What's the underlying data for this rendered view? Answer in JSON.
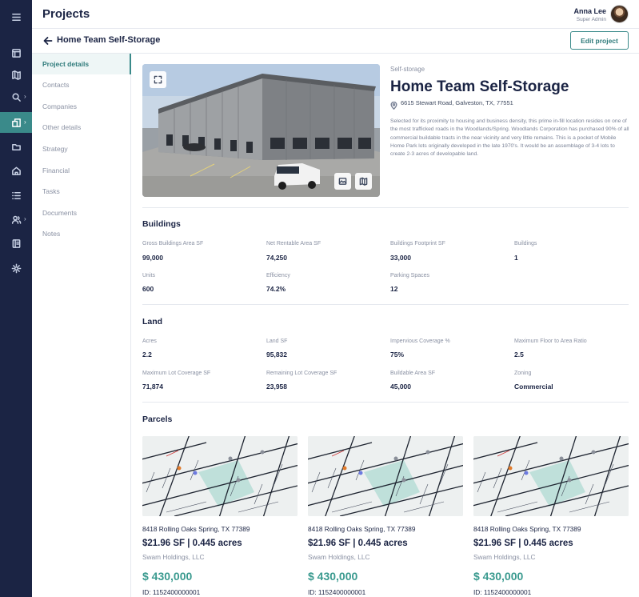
{
  "header": {
    "title": "Projects",
    "user_name": "Anna Lee",
    "user_role": "Super Admin"
  },
  "rail": {
    "items": [
      {
        "icon": "menu-icon"
      },
      {
        "icon": "dashboard-icon"
      },
      {
        "icon": "map-icon"
      },
      {
        "icon": "search-icon"
      },
      {
        "icon": "projects-icon",
        "active": true
      },
      {
        "icon": "folder-icon"
      },
      {
        "icon": "home-icon"
      },
      {
        "icon": "list-icon"
      },
      {
        "icon": "users-icon"
      },
      {
        "icon": "reports-icon"
      },
      {
        "icon": "settings-icon"
      }
    ]
  },
  "subheader": {
    "project_name": "Home Team Self-Storage",
    "edit_label": "Edit project"
  },
  "subnav": {
    "items": [
      "Project details",
      "Contacts",
      "Companies",
      "Other details",
      "Strategy",
      "Financial",
      "Tasks",
      "Documents",
      "Notes"
    ],
    "active": "Project details"
  },
  "project": {
    "category": "Self-storage",
    "name": "Home Team Self-Storage",
    "address": "6615 Stewart Road, Galveston, TX, 77551",
    "description": "Selected for its proximity to housing and business density, this prime in-fill location resides on one of the most trafficked roads in the Woodlands/Spring.  Woodlands Corporation has purchased 90% of all commercial buildable tracts in the near vicinity and very little remains.  This is a pocket of Mobile Home Park lots originally developed in the late 1970's.  It would be an assemblage of 3-4 lots to create 2-3 acres of developable land."
  },
  "buildings": {
    "title": "Buildings",
    "fields": [
      {
        "label": "Gross Buildings Area SF",
        "value": "99,000"
      },
      {
        "label": "Net Rentable Area SF",
        "value": "74,250"
      },
      {
        "label": "Buildings Footprint SF",
        "value": "33,000"
      },
      {
        "label": "Buildings",
        "value": "1"
      },
      {
        "label": "Units",
        "value": "600"
      },
      {
        "label": "Efficiency",
        "value": "74.2%"
      },
      {
        "label": "Parking Spaces",
        "value": "12"
      }
    ]
  },
  "land": {
    "title": "Land",
    "fields": [
      {
        "label": "Acres",
        "value": "2.2"
      },
      {
        "label": "Land SF",
        "value": "95,832"
      },
      {
        "label": "Impervious Coverage %",
        "value": "75%"
      },
      {
        "label": "Maximum Floor to Area Ratio",
        "value": "2.5"
      },
      {
        "label": "Maximum Lot Coverage SF",
        "value": "71,874"
      },
      {
        "label": "Remaining Lot Coverage SF",
        "value": "23,958"
      },
      {
        "label": "Buildable Area SF",
        "value": "45,000"
      },
      {
        "label": "Zoning",
        "value": "Commercial"
      }
    ]
  },
  "parcels": {
    "title": "Parcels",
    "items": [
      {
        "address": "8418 Rolling Oaks Spring, TX 77389",
        "size": "$21.96 SF | 0.445 acres",
        "owner": "Swam Holdings, LLC",
        "price": "$ 430,000",
        "id": "ID: 1152400000001"
      },
      {
        "address": "8418 Rolling Oaks Spring, TX 77389",
        "size": "$21.96 SF | 0.445 acres",
        "owner": "Swam Holdings, LLC",
        "price": "$ 430,000",
        "id": "ID: 1152400000001"
      },
      {
        "address": "8418 Rolling Oaks Spring, TX 77389",
        "size": "$21.96 SF | 0.445 acres",
        "owner": "Swam Holdings, LLC",
        "price": "$ 430,000",
        "id": "ID: 1152400000001"
      }
    ]
  },
  "colors": {
    "rail_bg": "#1b2444",
    "accent": "#3a8a8a",
    "price": "#3a9a8f"
  }
}
